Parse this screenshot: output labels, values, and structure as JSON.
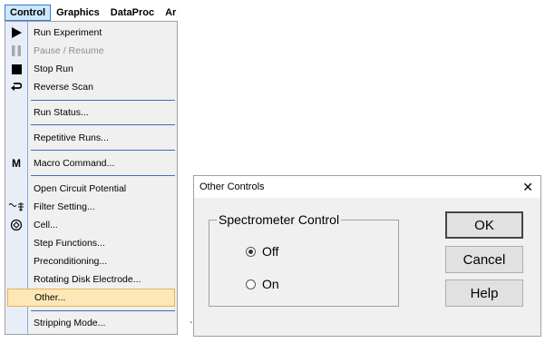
{
  "menubar": {
    "items": [
      "Control",
      "Graphics",
      "DataProc",
      "Ar"
    ]
  },
  "menu": {
    "run_experiment": "Run Experiment",
    "pause_resume": "Pause / Resume",
    "stop_run": "Stop Run",
    "reverse_scan": "Reverse Scan",
    "run_status": "Run Status...",
    "repetitive_runs": "Repetitive Runs...",
    "macro_command": "Macro Command...",
    "open_circuit_potential": "Open Circuit Potential",
    "filter_setting": "Filter Setting...",
    "cell": "Cell...",
    "step_functions": "Step Functions...",
    "preconditioning": "Preconditioning...",
    "rotating_disk_electrode": "Rotating Disk Electrode...",
    "other": "Other...",
    "stripping_mode": "Stripping Mode...",
    "macro_icon_letter": "M"
  },
  "dialog": {
    "title": "Other Controls",
    "close_glyph": "✕",
    "group_title": "Spectrometer Control",
    "options": [
      "Off",
      "On"
    ],
    "selected_option": "Off",
    "ok_label": "OK",
    "cancel_label": "Cancel",
    "help_label": "Help"
  },
  "stray_mark": "`",
  "colors": {
    "menu_highlight": "#fde7b7",
    "menu_accent": "#3c6fbe",
    "dialog_bg": "#f0f0f0"
  }
}
